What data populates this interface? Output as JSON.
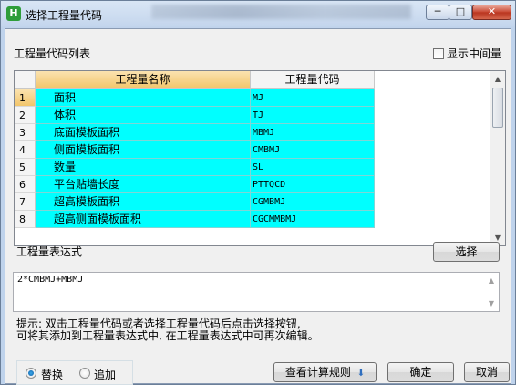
{
  "window": {
    "title": "选择工程量代码",
    "app_icon_glyph": "H",
    "min_glyph": "─",
    "max_glyph": "□",
    "close_glyph": "✕"
  },
  "list": {
    "label": "工程量代码列表",
    "show_intermediate_label": "显示中间量",
    "columns": [
      "工程量名称",
      "工程量代码"
    ],
    "rows": [
      {
        "num": "1",
        "name": "面积",
        "code": "MJ"
      },
      {
        "num": "2",
        "name": "体积",
        "code": "TJ"
      },
      {
        "num": "3",
        "name": "底面模板面积",
        "code": "MBMJ"
      },
      {
        "num": "4",
        "name": "侧面模板面积",
        "code": "CMBMJ"
      },
      {
        "num": "5",
        "name": "数量",
        "code": "SL"
      },
      {
        "num": "6",
        "name": "平台贴墙长度",
        "code": "PTTQCD"
      },
      {
        "num": "7",
        "name": "超高模板面积",
        "code": "CGMBMJ"
      },
      {
        "num": "8",
        "name": "超高侧面模板面积",
        "code": "CGCMMBMJ"
      }
    ],
    "scroll_up": "▲",
    "scroll_down": "▼"
  },
  "expression": {
    "label": "工程量表达式",
    "select_button": "选择",
    "value": "2*CMBMJ+MBMJ",
    "scroll_up": "▲",
    "scroll_down": "▼"
  },
  "hint": {
    "line1": "提示: 双击工程量代码或者选择工程量代码后点击选择按钮,",
    "line2": "可将其添加到工程量表达式中, 在工程量表达式中可再次编辑。"
  },
  "mode": {
    "replace_label": "替换",
    "append_label": "追加"
  },
  "footer": {
    "rules_button": "查看计算规则",
    "rules_arrow": "⬇",
    "ok_button": "确定",
    "cancel_button": "取消"
  },
  "colors": {
    "row_background": "#00ffff",
    "header_highlight": "#f2c56a"
  }
}
